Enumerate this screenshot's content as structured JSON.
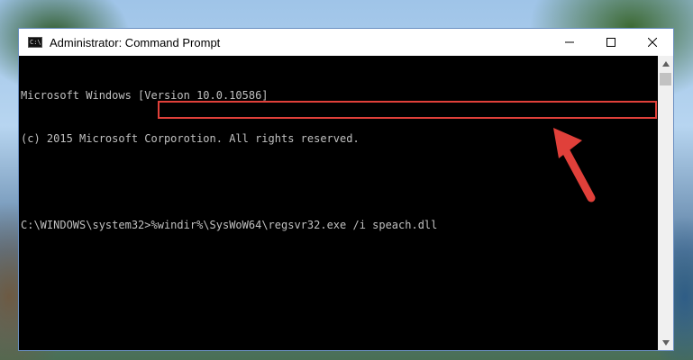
{
  "window": {
    "title": "Administrator: Command Prompt",
    "icon": "cmd-icon",
    "controls": {
      "minimize_icon": "minimize-icon",
      "maximize_icon": "maximize-icon",
      "close_icon": "close-icon"
    }
  },
  "console": {
    "lines": [
      "Microsoft Windows [Version 10.0.10586]",
      "(c) 2015 Microsoft Corporotion. All rights reserved."
    ],
    "prompt": "C:\\WINDOWS\\system32>",
    "command": "%windir%\\SysWoW64\\regsvr32.exe /i speach.dll"
  },
  "annotation": {
    "highlight_color": "#e0403a",
    "arrow_icon": "red-arrow-icon"
  }
}
